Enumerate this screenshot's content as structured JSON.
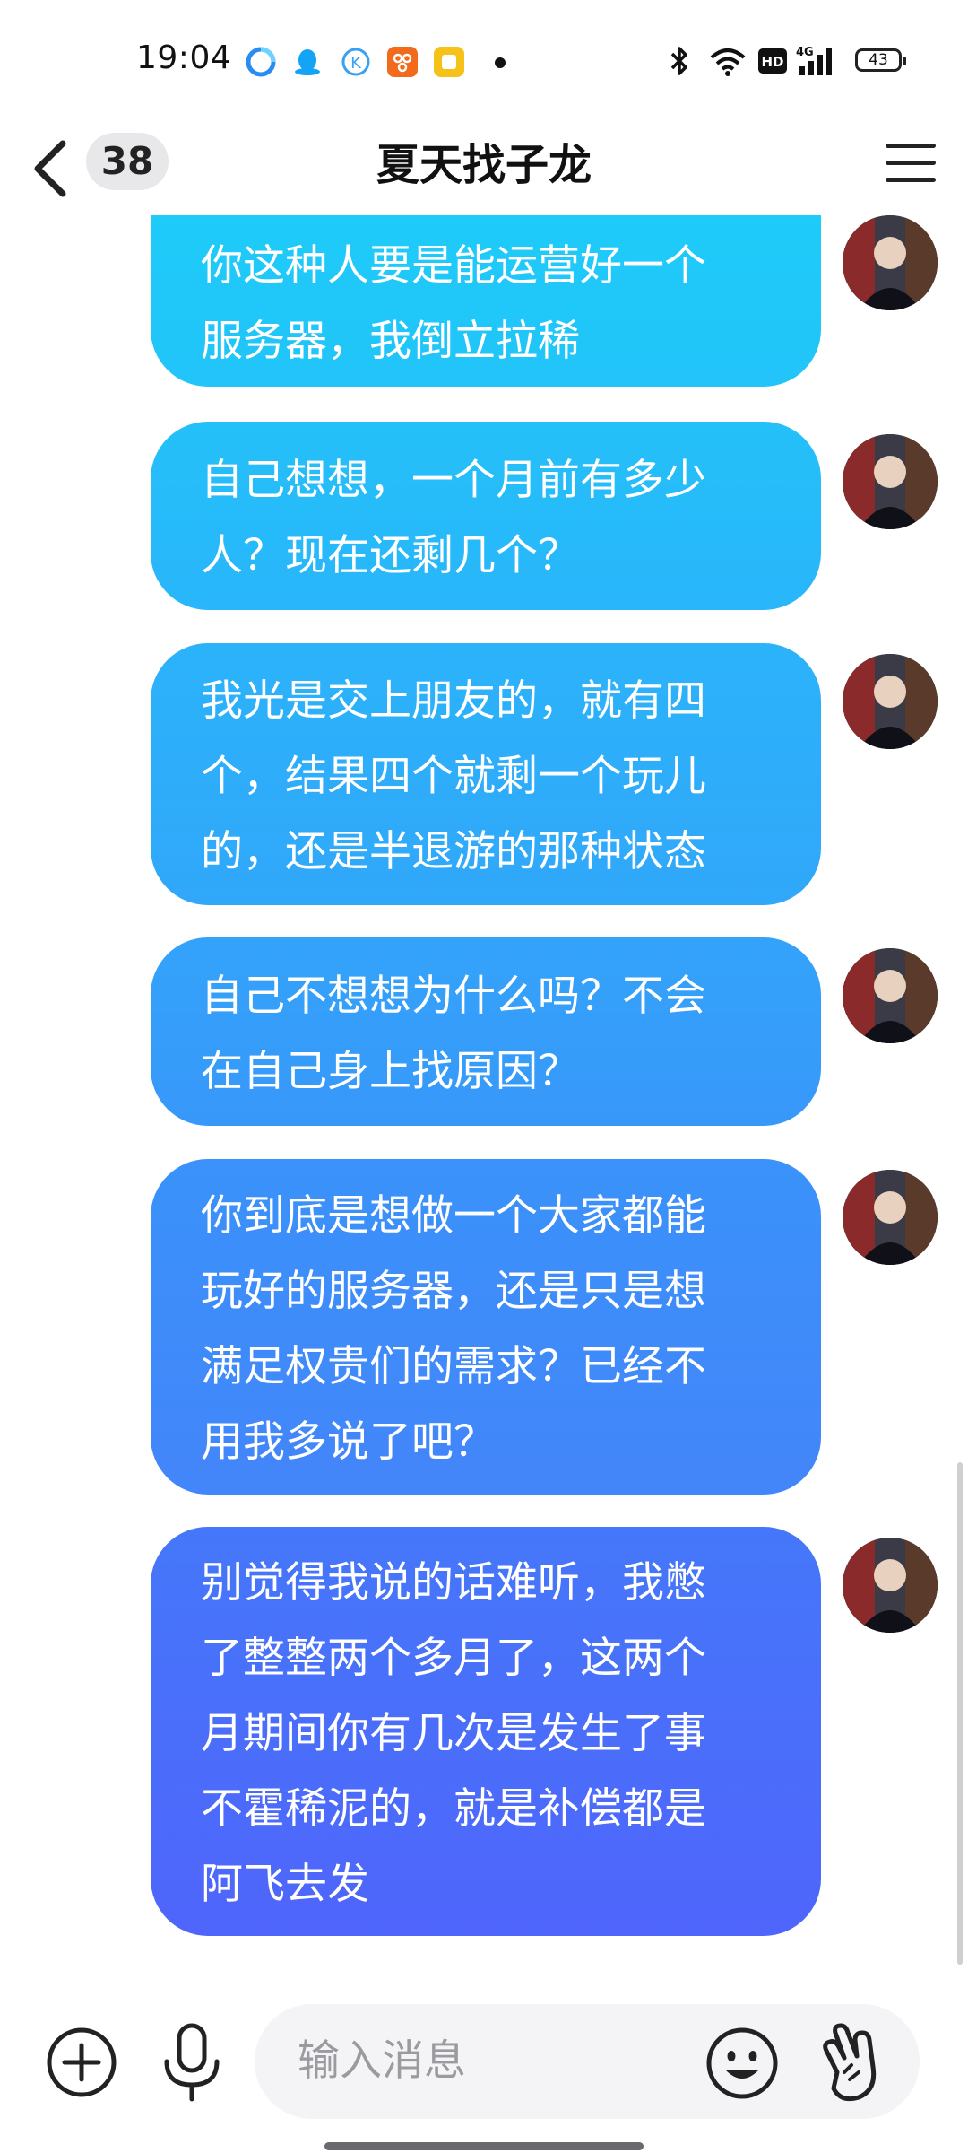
{
  "status_bar": {
    "time": "19:04",
    "app_icons": [
      "browser-icon",
      "qq-icon",
      "k-app-icon",
      "orange-app-icon",
      "notes-app-icon"
    ],
    "system_icons": [
      "bluetooth-icon",
      "wifi-icon",
      "hd-icon",
      "signal-4g-icon"
    ],
    "network": "4G",
    "hd_label": "HD",
    "battery": "43"
  },
  "nav": {
    "unread_count": "38",
    "title": "夏天找子龙"
  },
  "messages": [
    {
      "lines": [
        "你这种人要是能运营好一个",
        "服务器，我倒立拉稀"
      ]
    },
    {
      "lines": [
        "自己想想，一个月前有多少",
        "人？现在还剩几个？"
      ]
    },
    {
      "lines": [
        "我光是交上朋友的，就有四",
        "个，结果四个就剩一个玩儿",
        "的，还是半退游的那种状态"
      ]
    },
    {
      "lines": [
        "自己不想想为什么吗？不会",
        "在自己身上找原因？"
      ]
    },
    {
      "lines": [
        "你到底是想做一个大家都能",
        "玩好的服务器，还是只是想",
        "满足权贵们的需求？已经不",
        "用我多说了吧？"
      ]
    },
    {
      "lines": [
        "别觉得我说的话难听，我憋",
        "了整整两个多月了，这两个",
        "月期间你有几次是发生了事",
        "不霍稀泥的，就是补偿都是",
        "阿飞去发"
      ]
    }
  ],
  "input": {
    "placeholder": "输入消息"
  },
  "colors": {
    "bubble_top": "#1ecbf9",
    "bubble_bottom": "#4f65fb",
    "badge_bg": "#e8e8ea"
  }
}
